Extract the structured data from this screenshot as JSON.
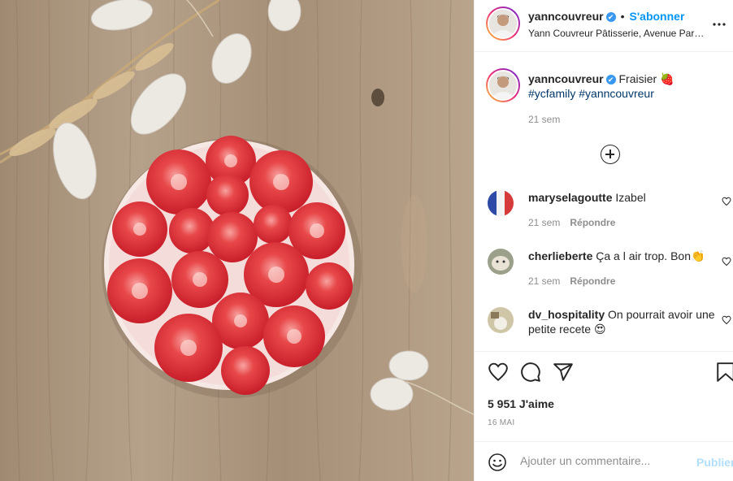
{
  "post": {
    "username": "yanncouvreur",
    "verified_mark": "✔",
    "follow_label": "S'abonner",
    "dot": "•",
    "location": "Yann Couvreur Pâtisserie, Avenue Parmentier",
    "more_icon": "more-horizontal-icon"
  },
  "caption": {
    "username": "yanncouvreur",
    "text": "Fraisier",
    "emoji": "🍓",
    "hashtags": [
      "#ycfamily",
      "#yanncouvreur"
    ],
    "time": "21 sem"
  },
  "load_more_icon": "plus-circle-icon",
  "comments": [
    {
      "username": "maryselagoutte",
      "text": "Izabel",
      "time": "21 sem",
      "reply": "Répondre"
    },
    {
      "username": "cherlieberte",
      "text": "Ça a l air trop. Bon",
      "emoji": "👏",
      "time": "21 sem",
      "reply": "Répondre"
    },
    {
      "username": "dv_hospitality",
      "text": "On pourrait avoir une petite recete",
      "emoji": "😍"
    }
  ],
  "actions": {
    "like_icon": "heart-icon",
    "comment_icon": "comment-icon",
    "share_icon": "share-icon",
    "save_icon": "bookmark-icon"
  },
  "likes": "5 951 J'aime",
  "date": "16 MAI",
  "add_comment": {
    "placeholder": "Ajouter un commentaire...",
    "publish_label": "Publier"
  },
  "colors": {
    "accent": "#0095f6",
    "hashtag": "#00376b",
    "muted": "#8e8e8e",
    "publish_disabled": "#b2dffc"
  }
}
